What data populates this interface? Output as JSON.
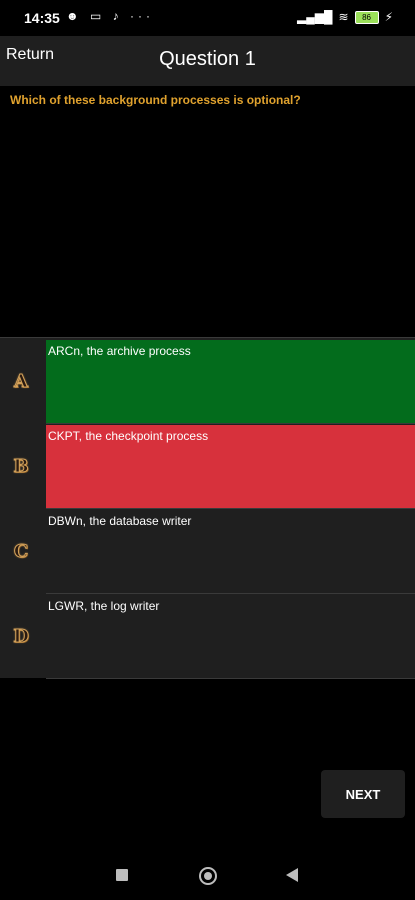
{
  "status_bar": {
    "time": "14:35",
    "left_icons": [
      "notification-icon",
      "laptop-icon",
      "tiktok-icon",
      "more-dots-icon"
    ],
    "left_icons_glyphs": "☻ ▭ ♪ ···",
    "signal": "▂▄▆█",
    "wifi": "≋",
    "battery": "86",
    "charging": "⚡"
  },
  "header": {
    "return_label": "Return",
    "title": "Question 1"
  },
  "question": {
    "text": "Which of these background processes is optional?"
  },
  "answers": [
    {
      "letter": "A",
      "text": "ARCn, the archive process",
      "state": "correct",
      "color": "#036c1c"
    },
    {
      "letter": "B",
      "text": "CKPT, the checkpoint process",
      "state": "wrong",
      "color": "#d7313c"
    },
    {
      "letter": "C",
      "text": "DBWn, the database writer",
      "state": "neutral",
      "color": "#1f1f1f"
    },
    {
      "letter": "D",
      "text": "LGWR, the log writer",
      "state": "neutral",
      "color": "#1f1f1f"
    }
  ],
  "footer": {
    "next_label": "NEXT"
  },
  "colors": {
    "accent": "#e0a22e",
    "correct": "#036c1c",
    "wrong": "#d7313c",
    "surface": "#1f1f1f"
  }
}
